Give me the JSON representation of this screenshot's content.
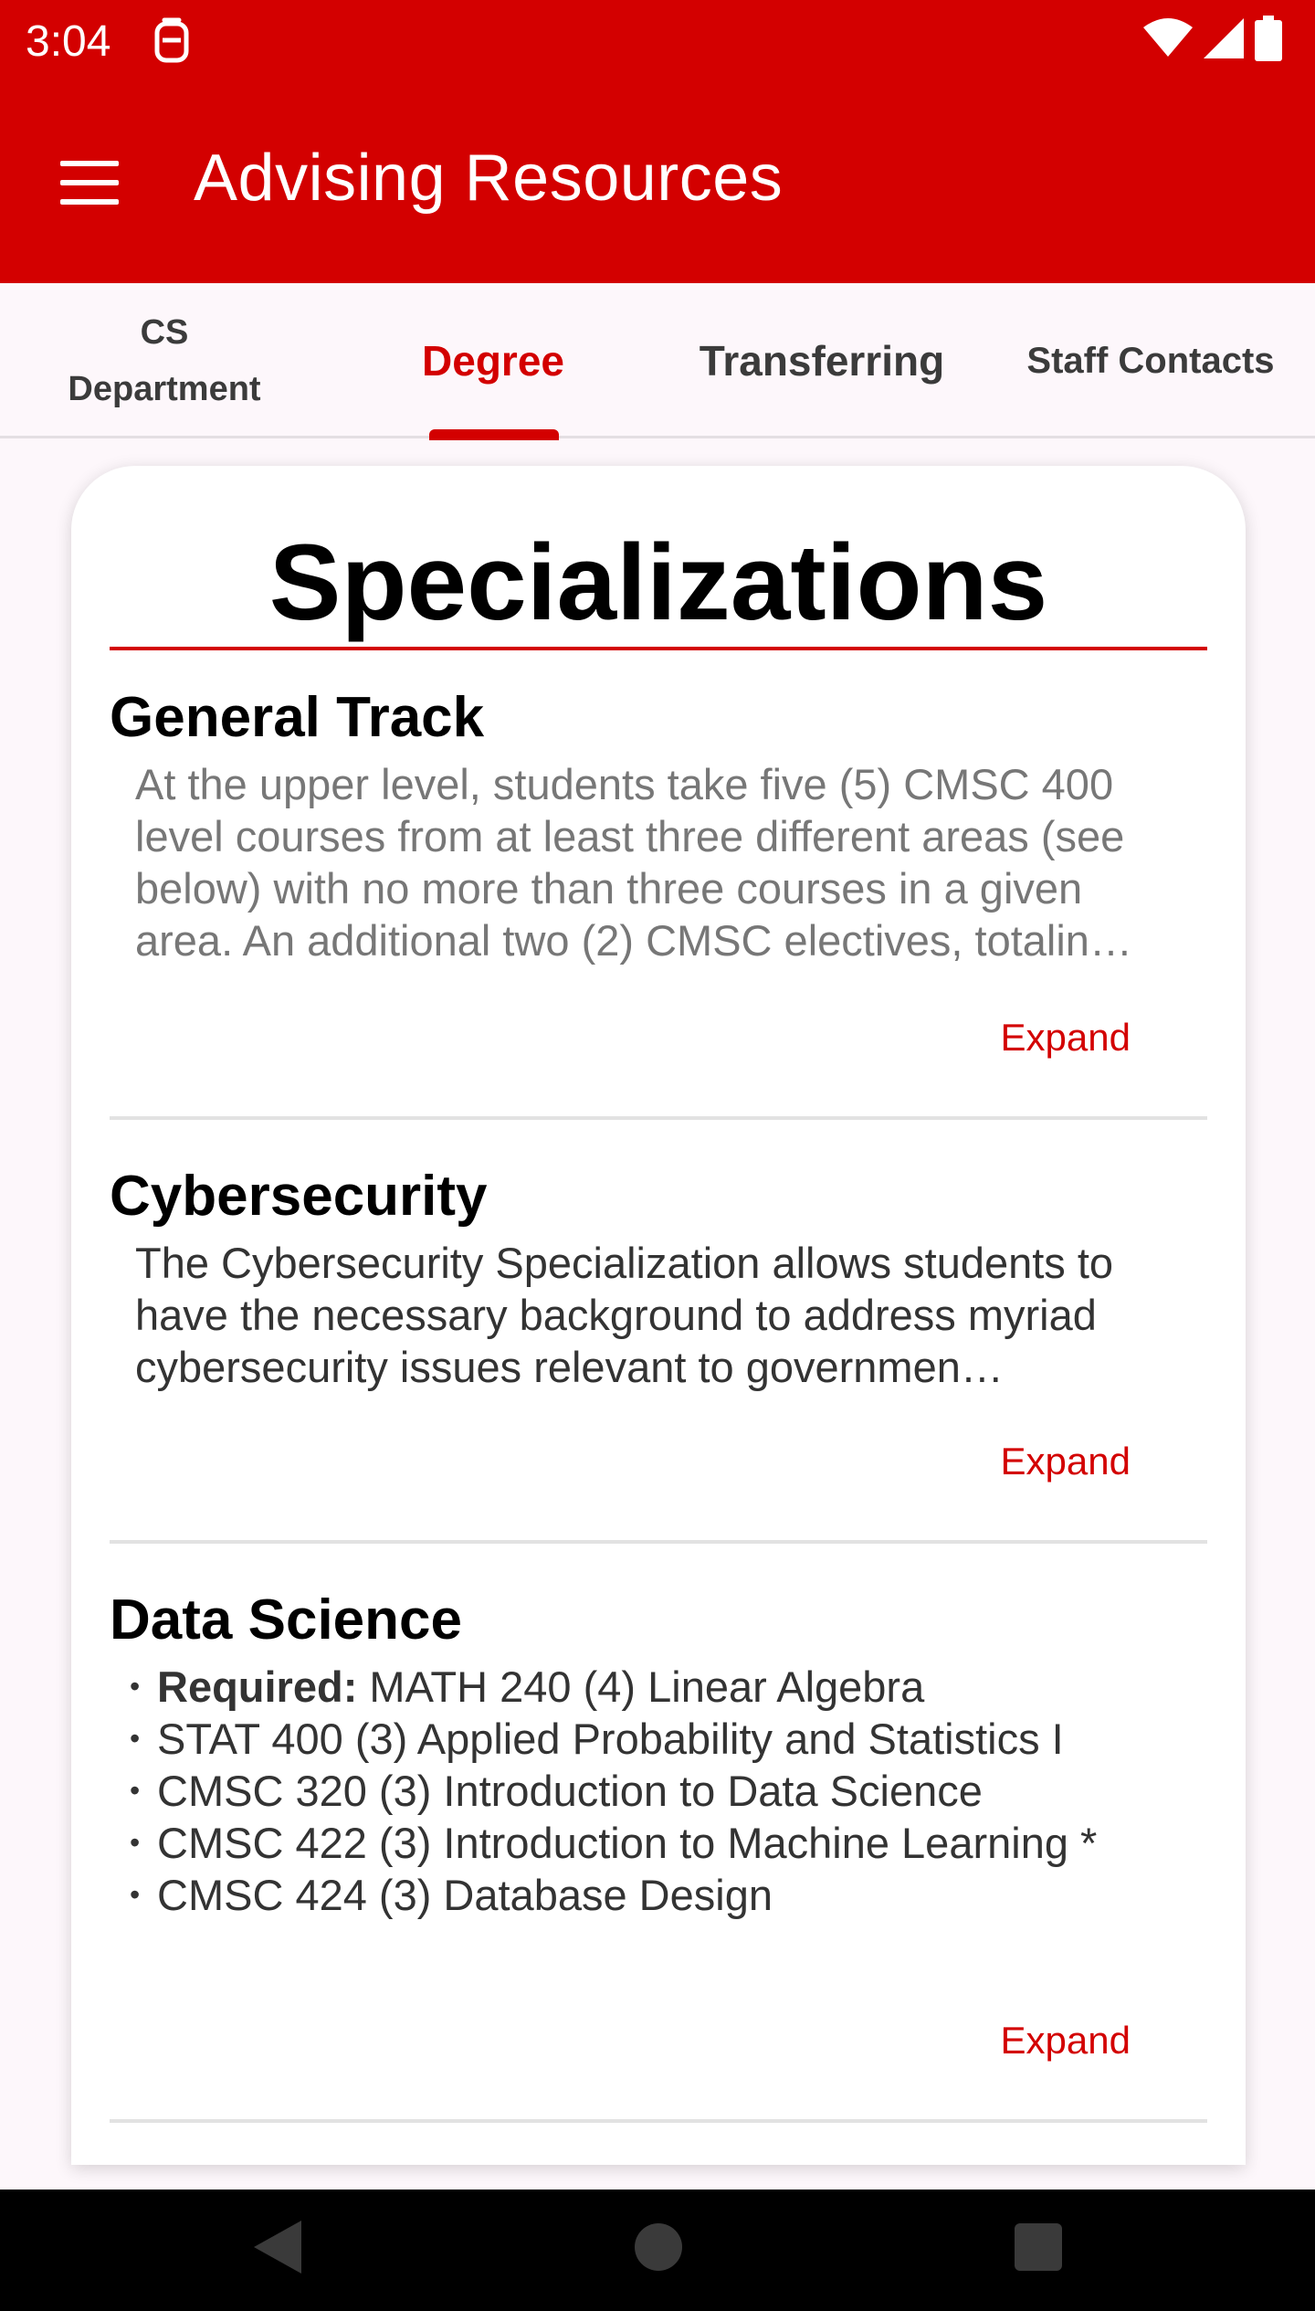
{
  "status_bar": {
    "time": "3:04",
    "icons": [
      "notification-icon",
      "wifi-icon",
      "signal-icon",
      "battery-icon"
    ]
  },
  "app_bar": {
    "title": "Advising Resources",
    "menu_icon": "hamburger-menu-icon"
  },
  "tabs": [
    {
      "label": "CS Department",
      "selected": false
    },
    {
      "label": "Degree",
      "selected": true
    },
    {
      "label": "Transferring",
      "selected": false
    },
    {
      "label": "Staff Contacts",
      "selected": false
    }
  ],
  "card": {
    "title": "Specializations",
    "sections": [
      {
        "heading": "General Track",
        "body": "At the upper level, students take five (5) CMSC 400 level courses from at least three different areas (see below) with no more than three courses in a given area. An additional two (2) CMSC electives, totalin…",
        "expand_label": "Expand"
      },
      {
        "heading": "Cybersecurity",
        "body": "The Cybersecurity Specialization allows students to have the necessary background to address myriad cybersecurity issues relevant to governmen…",
        "expand_label": "Expand"
      },
      {
        "heading": "Data Science",
        "items": [
          {
            "prefix": "Required:",
            "text": " MATH 240 (4) Linear Algebra"
          },
          {
            "prefix": "",
            "text": "STAT 400 (3) Applied Probability and Statistics I"
          },
          {
            "prefix": "",
            "text": "CMSC 320 (3) Introduction to Data Science"
          },
          {
            "prefix": "",
            "text": "CMSC 422 (3) Introduction to Machine Learning *"
          },
          {
            "prefix": "",
            "text": "CMSC 424 (3) Database Design"
          }
        ],
        "expand_label": "Expand"
      }
    ]
  },
  "colors": {
    "primary": "#d30000",
    "background": "#fdf7fb",
    "nav_bar": "#000000"
  },
  "nav_bar": {
    "icons": [
      "back-icon",
      "home-icon",
      "recents-icon"
    ]
  }
}
